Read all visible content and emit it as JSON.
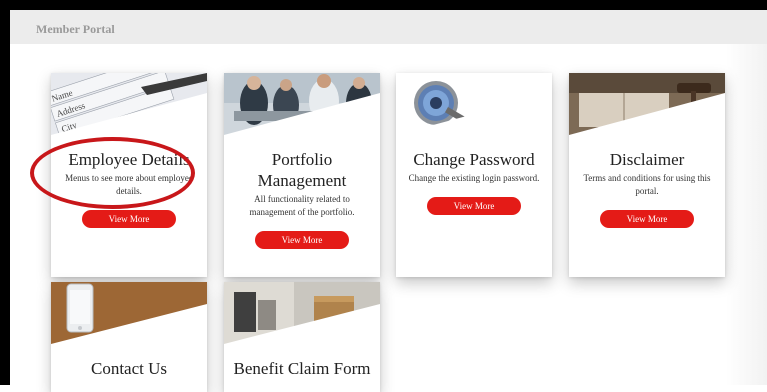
{
  "header": {
    "title": "Member Portal"
  },
  "cards": [
    {
      "title": "Employee Details",
      "description": "Menus to see more about employee details.",
      "button": "View More",
      "image": "address-form-pen-image"
    },
    {
      "title": "Portfolio Management",
      "description": "All functionality related to management of the portfolio.",
      "button": "View More",
      "image": "business-meeting-image"
    },
    {
      "title": "Change Password",
      "description": "Change the existing login password.",
      "button": "View More",
      "image": "keychain-lock-image"
    },
    {
      "title": "Disclaimer",
      "description": "Terms and conditions for using this portal.",
      "button": "View More",
      "image": "gavel-law-book-image"
    },
    {
      "title": "Contact Us",
      "image": "smartphone-image"
    },
    {
      "title": "Benefit Claim Form",
      "image": "office-boxes-image"
    }
  ],
  "colors": {
    "button": "#e41b17",
    "annotation_ring": "#c8171a",
    "header_bar": "#ececec"
  }
}
